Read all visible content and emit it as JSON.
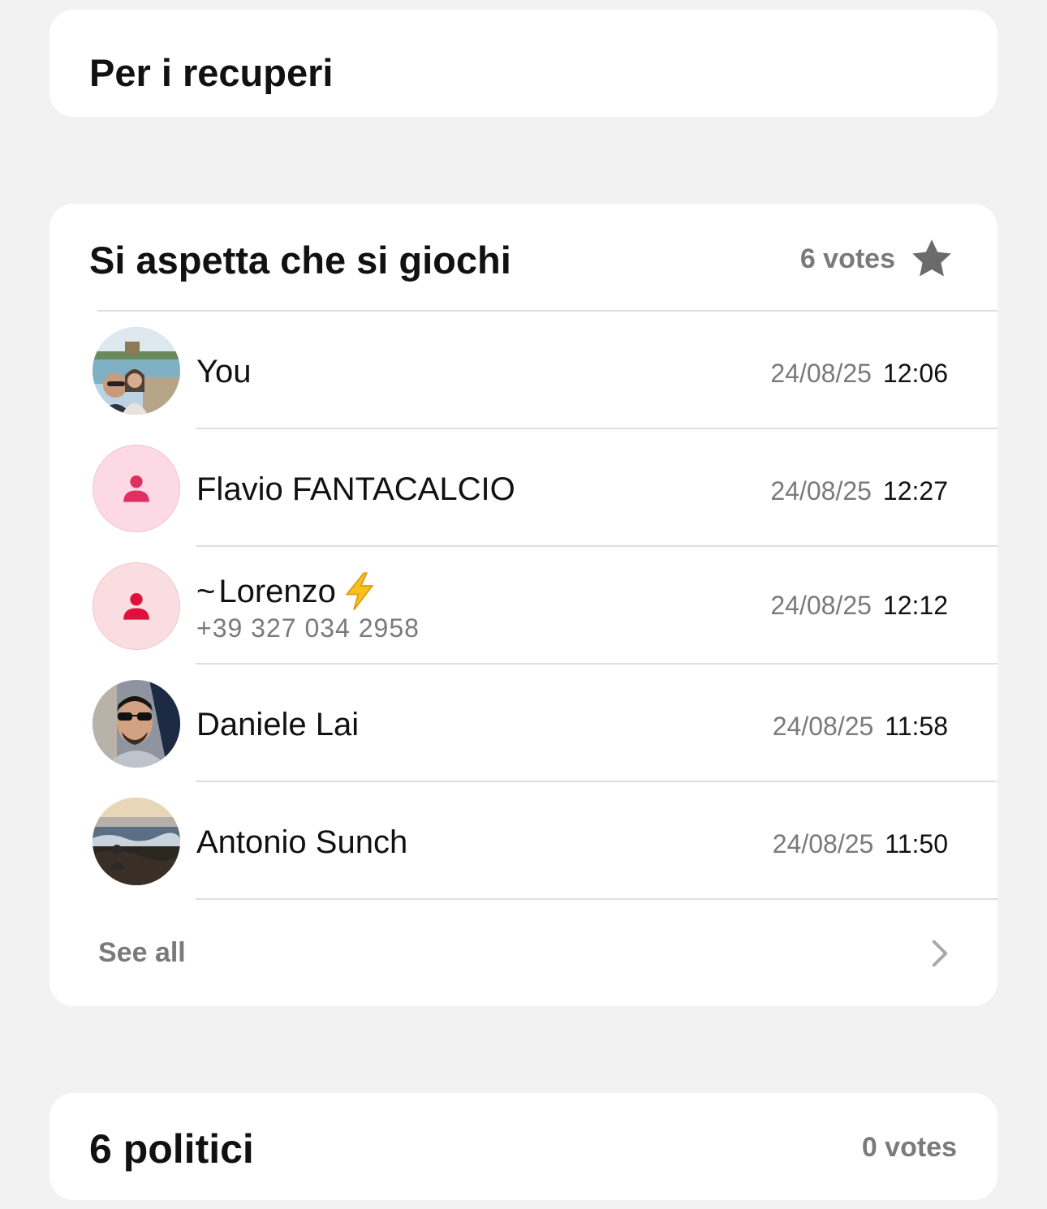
{
  "poll_options": [
    {
      "title": "Per i recuperi"
    },
    {
      "title": "Si aspetta che si giochi",
      "votes": "6 votes",
      "star_icon": "star-icon",
      "voters": [
        {
          "name": "You",
          "date": "24/08/25",
          "time": "12:06",
          "avatar": "photo-couple-beach"
        },
        {
          "name": "Flavio FANTACALCIO",
          "date": "24/08/25",
          "time": "12:27",
          "avatar": "default-person-icon",
          "avatar_bg": "#fcd9e4",
          "icon_color": "#e0305f"
        },
        {
          "name_prefix": "~",
          "name": "Lorenzo",
          "name_emoji": "lightning-emoji",
          "phone": "+39 327 034 2958",
          "date": "24/08/25",
          "time": "12:12",
          "avatar": "default-person-icon",
          "avatar_bg": "#f9dde1",
          "icon_color": "#e0103a"
        },
        {
          "name": "Daniele Lai",
          "date": "24/08/25",
          "time": "11:58",
          "avatar": "photo-man-sunglasses"
        },
        {
          "name": "Antonio Sunch",
          "date": "24/08/25",
          "time": "11:50",
          "avatar": "photo-sea-sunset"
        }
      ],
      "see_all": "See all"
    },
    {
      "title": "6 politici",
      "votes": "0 votes"
    }
  ],
  "colors": {
    "background": "#f2f2f2",
    "card": "#ffffff",
    "secondary_text": "#7a7a7a",
    "divider": "#dedede"
  }
}
